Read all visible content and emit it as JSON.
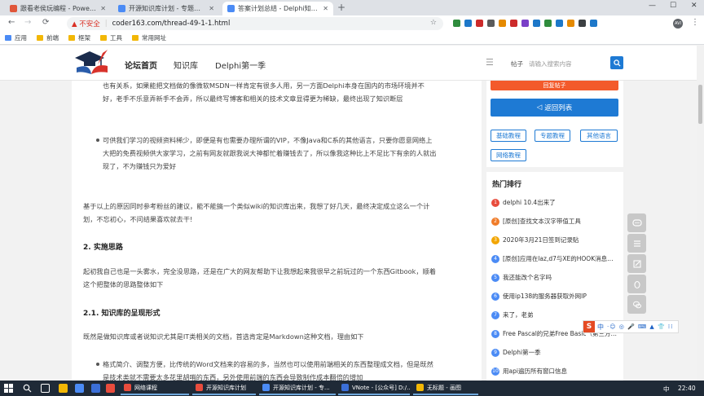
{
  "browser": {
    "tabs": [
      {
        "title": "跟看老侯玩编程 - Powered by D",
        "color": "#e0563a"
      },
      {
        "title": "开源知识库计划 - 专题教程 - 新·",
        "color": "#4b8bf5"
      },
      {
        "title": "答案计划总结 - Delphi知识库",
        "color": "#4b8bf5"
      }
    ],
    "tab_close": "✕",
    "new_tab": "+",
    "window_controls": {
      "minimize": "—",
      "maximize": "☐",
      "close": "✕"
    },
    "back": "←",
    "forward": "→",
    "reload": "⟳",
    "security_label": "▲ 不安全",
    "url_separator": "|",
    "url": "coder163.com/thread-49-1-1.html",
    "star": "☆",
    "profile_initials": "AVI",
    "extension_colors": [
      "#2f8c3d",
      "#1d78c9",
      "#cc2b2b",
      "#5b5b5b",
      "#e58a00",
      "#cc2b2b",
      "#7a3fc8",
      "#1d78c9",
      "#2f8c3d",
      "#1d78c9",
      "#e58a00",
      "#3c4043",
      "#1d78c9"
    ]
  },
  "bookmarks": [
    {
      "label": "应用",
      "color": "#4b8bf5"
    },
    {
      "label": "前端",
      "color": "#f2b705"
    },
    {
      "label": "框架",
      "color": "#f2b705"
    },
    {
      "label": "工具",
      "color": "#f2b705"
    },
    {
      "label": "常用网址",
      "color": "#f2b705"
    }
  ],
  "site": {
    "nav": [
      "论坛首页",
      "知识库",
      "Delphi第一季"
    ],
    "list_glyph": "☰",
    "search_type": "帖子",
    "search_placeholder": "请输入搜索内容"
  },
  "article": {
    "para1": [
      "也有关系，如果能把文档做的像微软MSDN一样肯定有很多人用，另一方面Delphi本身在国内的市场环境并不",
      "好，老手不乐意弄新手不会弄，所以最终写博客和相关的技术文章显得更为稀缺，最终出现了知识断层"
    ],
    "para2": [
      "可供我们学习的视频资料稀少，即便是有也需要办理所谓的VIP，不像Java和C系的其他语言，只要你愿意网络上",
      "大把的免费视频供大家学习，之前有网友就跟我说大神都忙着赚钱去了，所以像我这种比上不足比下有余的人就出",
      "现了，不为赚钱只为爱好"
    ],
    "para3": [
      "基于以上的原因同时参考粉丝的建议，能不能搞一个类似wiki的知识库出来，我想了好几天，最终决定成立这么一个计",
      "划，不忘初心，不问结果喜欢就去干!"
    ],
    "heading1": "2. 实施思路",
    "para4": [
      "起初我自己也是一头雾水，完全没思路，还是在广大的网友帮助下让我想起来我很早之前玩过的一个东西Gitbook，顺着",
      "这个把整体的思路整体如下"
    ],
    "heading2": "2.1. 知识库的呈现形式",
    "para5": "既然是做知识库或者说知识尤其是IT类相关的文档，首选肯定是Markdown这种文档，理由如下",
    "para6": [
      "格式简介、调整方便，比传统的Word文档来的容易的多，当然也可以使用前端相关的东西整理成文档，但是既然",
      "是技术类就不需要太多花里胡哨的东西，另外使用前端的东西会导致制作成本翻倍的增加"
    ]
  },
  "sidebar": {
    "red_button": "回复帖子",
    "blue_button": "返回列表",
    "blue_button_glyph": "◁",
    "tags": [
      "基础教程",
      "专题教程",
      "其他语言",
      "网络教程"
    ],
    "hot_title": "热门排行",
    "hot_items": [
      {
        "num": "1",
        "text": "delphi 10.4出来了",
        "color": "#e84c3d"
      },
      {
        "num": "2",
        "text": "[原创]查找文本汉字带值工具",
        "color": "#f07c29"
      },
      {
        "num": "3",
        "text": "2020年3月21日签到记录贴",
        "color": "#f2a500"
      },
      {
        "num": "4",
        "text": "[原创]应用在laz,d7与XE的HOOK消息框...",
        "color": "#4b8bf5"
      },
      {
        "num": "5",
        "text": "我还能改个名字吗",
        "color": "#4b8bf5"
      },
      {
        "num": "6",
        "text": "使用ip138的服务器获取外网IP",
        "color": "#4b8bf5"
      },
      {
        "num": "7",
        "text": "来了，老弟",
        "color": "#4b8bf5"
      },
      {
        "num": "8",
        "text": "Free Pascal的兄弟Free Basic（第三方IDE...",
        "color": "#4b8bf5"
      },
      {
        "num": "9",
        "text": "Delphi第一季",
        "color": "#4b8bf5"
      },
      {
        "num": "10",
        "text": "用api遍历所有窗口信息",
        "color": "#4b8bf5"
      }
    ]
  },
  "ime": {
    "logo": "S",
    "lang": "中",
    "glyphs": "·☺ ◎ 🎤 ⌨ ▲ 👕 ⁞⁞"
  },
  "taskbar": {
    "tasks": [
      {
        "label": "网络课程",
        "color": "#e84c3d"
      },
      {
        "label": "开源知识库计划",
        "color": "#e84c3d"
      },
      {
        "label": "开源知识库计划 - 专...",
        "color": "#4b8bf5"
      },
      {
        "label": "VNote - [公众号] D:/...",
        "color": "#3b6fd8"
      },
      {
        "label": "无标题 - 画图",
        "color": "#f2b705"
      }
    ],
    "ime_label": "中",
    "time": "22:40"
  }
}
